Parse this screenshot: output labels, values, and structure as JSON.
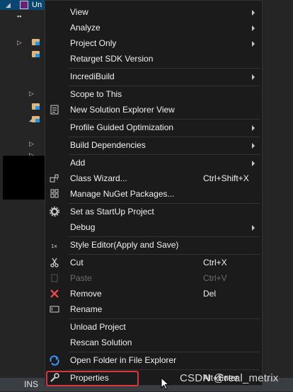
{
  "explorer": {
    "selected_project": "Un"
  },
  "menu": {
    "items": [
      {
        "label": "View"
      },
      {
        "label": "Analyze"
      },
      {
        "label": "Project Only"
      },
      {
        "label": "Retarget SDK Version"
      },
      {
        "label": "IncrediBuild"
      },
      {
        "label": "Scope to This"
      },
      {
        "label": "New Solution Explorer View"
      },
      {
        "label": "Profile Guided Optimization"
      },
      {
        "label": "Build Dependencies"
      },
      {
        "label": "Add"
      },
      {
        "label": "Class Wizard...",
        "shortcut": "Ctrl+Shift+X"
      },
      {
        "label": "Manage NuGet Packages..."
      },
      {
        "label": "Set as StartUp Project"
      },
      {
        "label": "Debug"
      },
      {
        "label": "Style Editor(Apply and Save)"
      },
      {
        "label": "Cut",
        "shortcut": "Ctrl+X"
      },
      {
        "label": "Paste",
        "shortcut": "Ctrl+V"
      },
      {
        "label": "Remove",
        "shortcut": "Del"
      },
      {
        "label": "Rename"
      },
      {
        "label": "Unload Project"
      },
      {
        "label": "Rescan Solution"
      },
      {
        "label": "Open Folder in File Explorer"
      },
      {
        "label": "Properties",
        "shortcut": "Alt+Enter"
      }
    ]
  },
  "statusbar": {
    "mode": "INS"
  },
  "watermark": "CSDN @real_metrix",
  "colors": {
    "menu_bg": "#1b1b1c",
    "menu_border": "#333337",
    "selection": "#094771",
    "highlight_box": "#d9363e",
    "status_bar": "#3a3d41"
  },
  "icons": [
    "solution-explorer-view-icon",
    "class-wizard-icon",
    "nuget-icon",
    "gear-icon",
    "style-editor-icon",
    "scissors-icon",
    "remove-x-icon",
    "rename-icon",
    "refresh-arrow-icon",
    "wrench-icon",
    "mouse-cursor-icon"
  ]
}
